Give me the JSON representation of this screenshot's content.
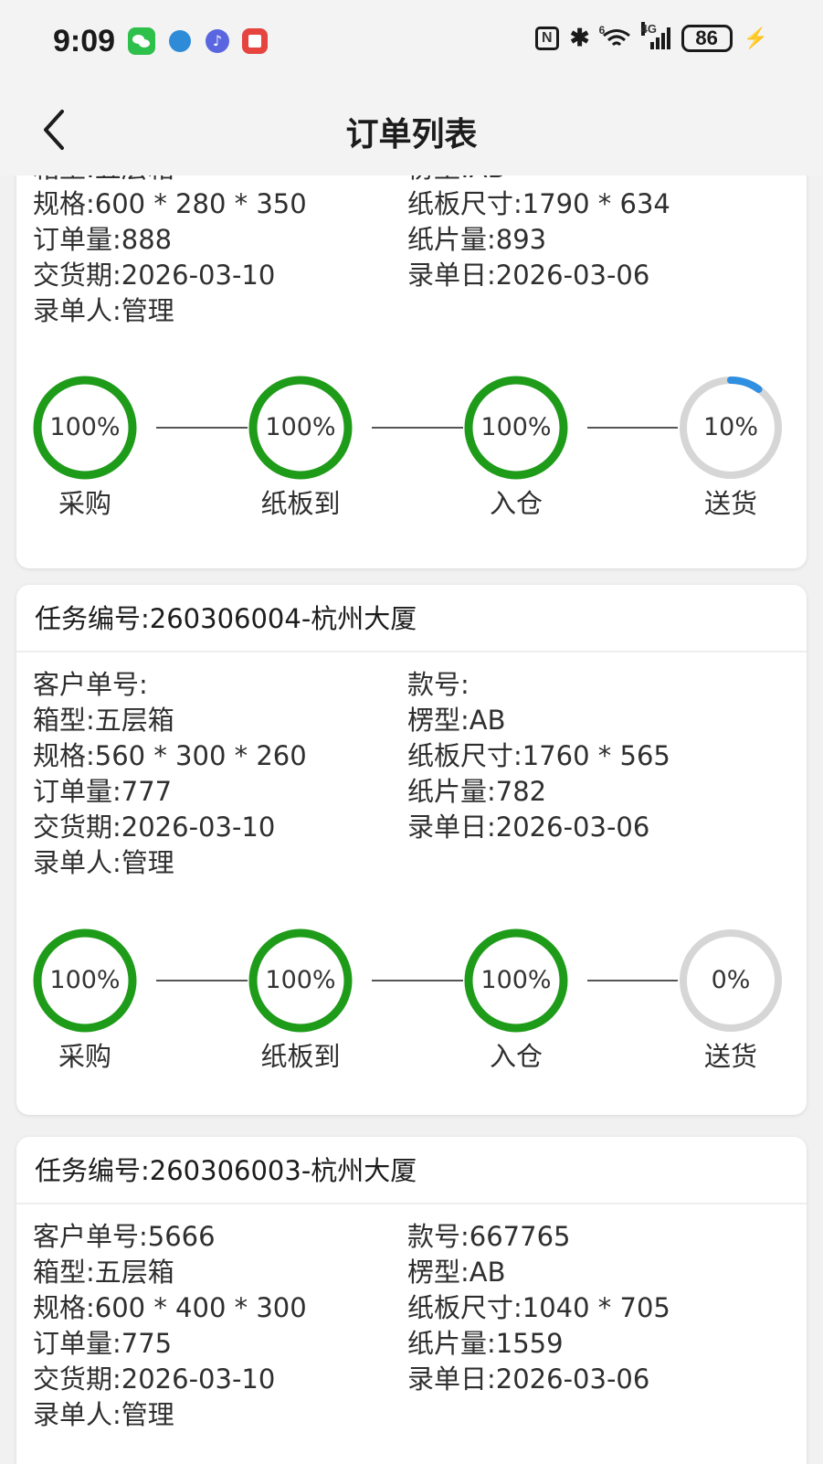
{
  "status_bar": {
    "time": "9:09",
    "battery": "86",
    "nfc": "N",
    "bluetooth": "✱",
    "wifi_label": "6",
    "signal_label": "4G",
    "charging": "⚡"
  },
  "header": {
    "title": "订单列表"
  },
  "colors": {
    "complete": "#1f9b1a",
    "track": "#d6d6d6",
    "in_progress": "#2f8fe0"
  },
  "cards": [
    {
      "partial": true,
      "fields_left": [
        "箱型:五层箱",
        "规格:600 * 280 * 350",
        "订单量:888",
        "交货期:2026-03-10",
        "录单人:管理"
      ],
      "fields_right": [
        "楞型:AB",
        "纸板尺寸:1790 * 634",
        "纸片量:893",
        "录单日:2026-03-06"
      ],
      "steps": [
        {
          "label": "采购",
          "percent": "100%",
          "value": 100
        },
        {
          "label": "纸板到",
          "percent": "100%",
          "value": 100
        },
        {
          "label": "入仓",
          "percent": "100%",
          "value": 100
        },
        {
          "label": "送货",
          "percent": "10%",
          "value": 10
        }
      ]
    },
    {
      "title": "任务编号:260306004-杭州大厦",
      "fields_left": [
        "客户单号:",
        "箱型:五层箱",
        "规格:560 * 300 * 260",
        "订单量:777",
        "交货期:2026-03-10",
        "录单人:管理"
      ],
      "fields_right": [
        "款号:",
        "楞型:AB",
        "纸板尺寸:1760 * 565",
        "纸片量:782",
        "录单日:2026-03-06"
      ],
      "steps": [
        {
          "label": "采购",
          "percent": "100%",
          "value": 100
        },
        {
          "label": "纸板到",
          "percent": "100%",
          "value": 100
        },
        {
          "label": "入仓",
          "percent": "100%",
          "value": 100
        },
        {
          "label": "送货",
          "percent": "0%",
          "value": 0
        }
      ]
    },
    {
      "title": "任务编号:260306003-杭州大厦",
      "fields_left": [
        "客户单号:5666",
        "箱型:五层箱",
        "规格:600 * 400 * 300",
        "订单量:775",
        "交货期:2026-03-10",
        "录单人:管理"
      ],
      "fields_right": [
        "款号:667765",
        "楞型:AB",
        "纸板尺寸:1040 * 705",
        "纸片量:1559",
        "录单日:2026-03-06"
      ]
    }
  ]
}
